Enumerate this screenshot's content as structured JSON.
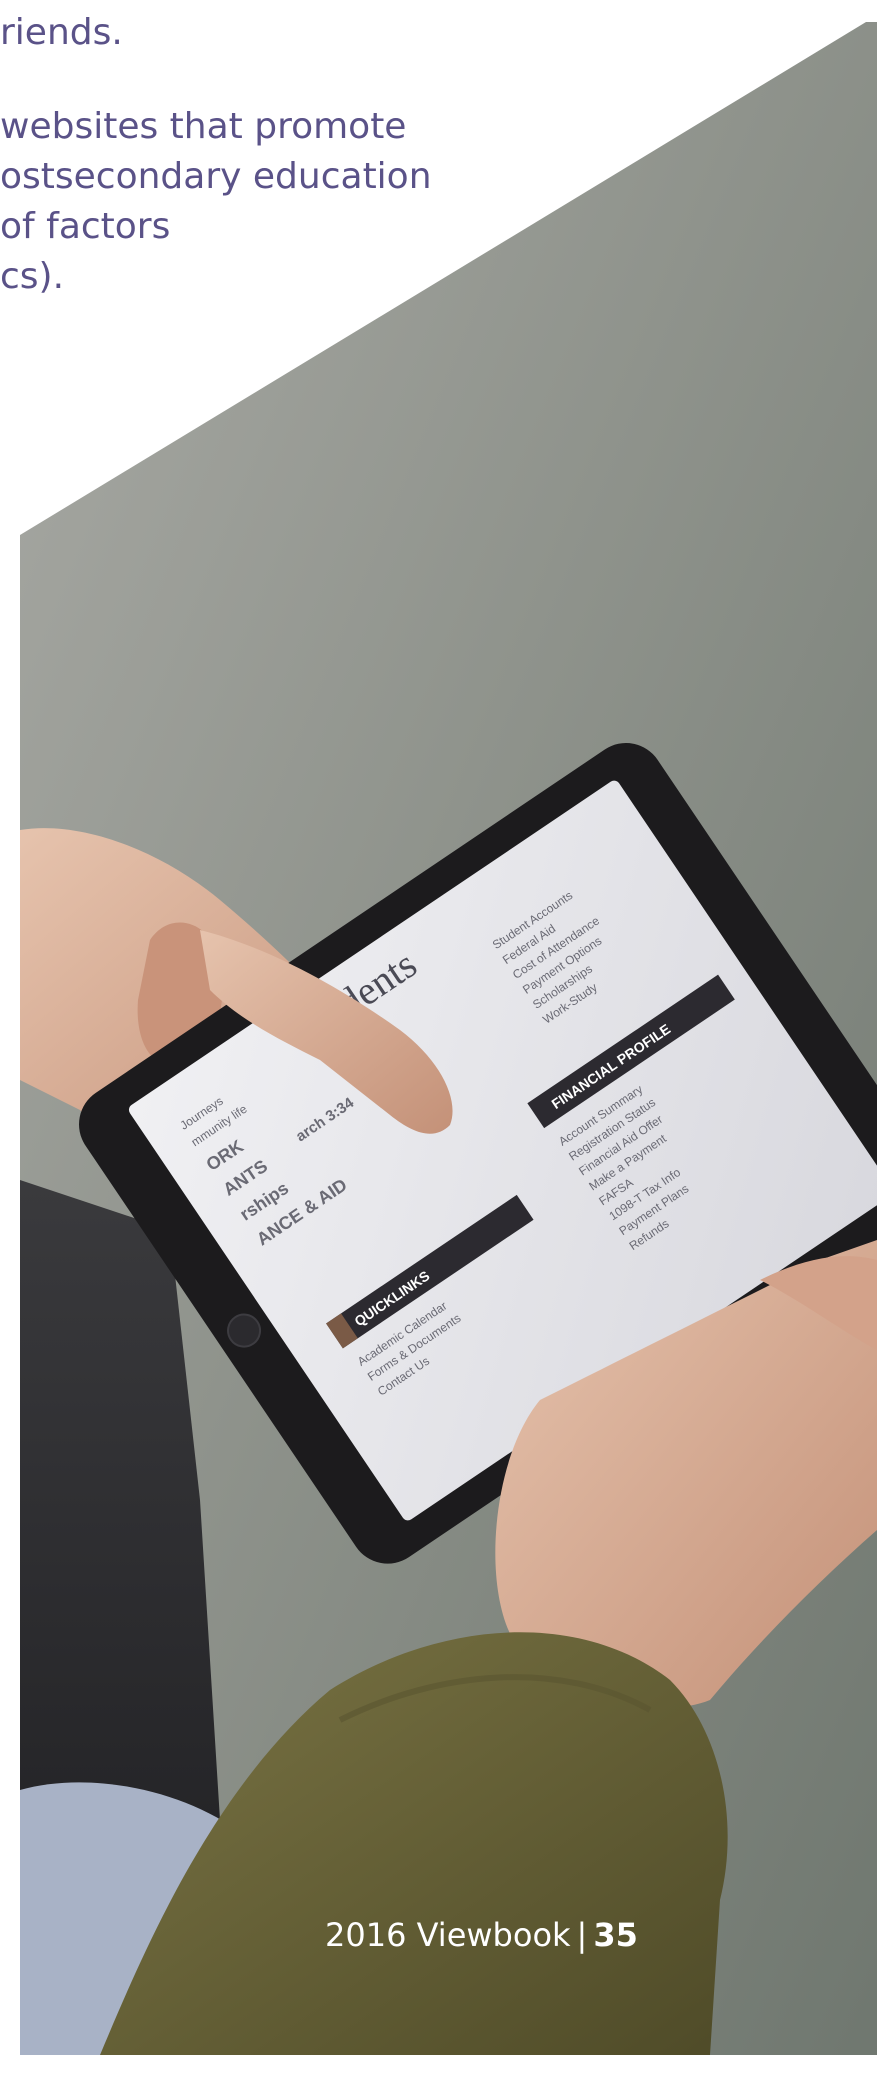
{
  "paragraphs": {
    "p1": [
      "riends."
    ],
    "p2": [
      "websites that promote",
      "ostsecondary education",
      "of factors",
      "cs)."
    ]
  },
  "tablet": {
    "title": "udents",
    "nav": [
      "Journeys",
      "mmunity life",
      "ORK",
      "ANTS",
      "rships",
      "arch 3:34",
      "ANCE & AID"
    ],
    "left_menu": [
      "Student Accounts",
      "Federal Aid",
      "Cost of Attendance",
      "Payment Options",
      "Scholarships",
      "Work-Study"
    ],
    "financial_profile": {
      "heading": "FINANCIAL PROFILE",
      "items": [
        "Account Summary",
        "Registration Status",
        "Financial Aid Offer",
        "Make a Payment",
        "FAFSA",
        "1098-T Tax Info",
        "Payment Plans",
        "Refunds"
      ]
    },
    "quick_links": {
      "heading": "QUICKLINKS",
      "items": [
        "Academic Calendar",
        "Forms & Documents",
        "Contact Us"
      ]
    }
  },
  "footer": {
    "label": "2016 Viewbook",
    "separator": "|",
    "page_number": "35"
  },
  "colors": {
    "text": "#5a5288",
    "footer_text": "#ffffff",
    "photo_bg": "#8e918a",
    "tablet_bezel": "#1c1b1d",
    "tablet_screen": "#e4e3e8",
    "skin": "#d9b199",
    "sleeve": "#6f6a3a"
  }
}
